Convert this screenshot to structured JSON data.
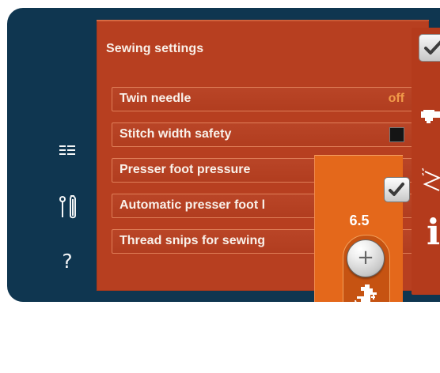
{
  "sidebar": {
    "items": [
      {
        "icon": "menu-icon"
      },
      {
        "icon": "tools-icon"
      },
      {
        "label": "?"
      }
    ]
  },
  "panel": {
    "title": "Sewing settings",
    "rows": [
      {
        "label": "Twin needle",
        "value": "off"
      },
      {
        "label": "Stitch width safety",
        "checked": false
      },
      {
        "label": "Presser foot pressure"
      },
      {
        "label": "Automatic presser foot l"
      },
      {
        "label": "Thread snips for sewing"
      }
    ]
  },
  "toolbar": {
    "items": [
      {
        "icon": "checkmark-icon"
      },
      {
        "icon": "sewing-machine-icon"
      },
      {
        "icon": "stitch-width-icon"
      },
      {
        "label": "i"
      }
    ]
  },
  "pressure_popup": {
    "value": "6.5",
    "plus_label": "+",
    "minus_label": "−",
    "foot_icon": "presser-foot-pressure-icon"
  },
  "colors": {
    "screen_background": "#0f3650",
    "panel_background": "#b73f20",
    "popup_background": "#e4681b",
    "accent_value": "#f19b49",
    "text": "#f9f1ea"
  }
}
